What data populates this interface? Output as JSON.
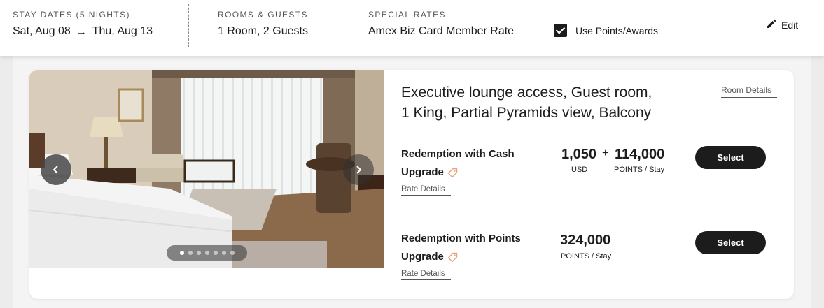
{
  "search_bar": {
    "stay_label": "STAY DATES (5 NIGHTS)",
    "check_in": "Sat, Aug 08",
    "check_out": "Thu, Aug 13",
    "rooms_label": "ROOMS & GUESTS",
    "rooms_value": "1 Room, 2 Guests",
    "special_label": "SPECIAL RATES",
    "special_value": "Amex Biz Card Member Rate",
    "use_points_label": "Use Points/Awards",
    "use_points_checked": true,
    "edit_label": "Edit"
  },
  "room": {
    "title_line1": "Executive lounge access, Guest room,",
    "title_line2": "1 King, Partial Pyramids view, Balcony",
    "room_details_label": "Room Details",
    "photo_count": 7,
    "photo_active_index": 0,
    "rates": [
      {
        "name_line1": "Redemption with Cash",
        "name_line2": "Upgrade",
        "rate_details_label": "Rate Details",
        "cash_amount": "1,050",
        "cash_unit": "USD",
        "plus": "+",
        "points_amount": "114,000",
        "points_unit": "POINTS / Stay",
        "select_label": "Select"
      },
      {
        "name_line1": "Redemption with Points",
        "name_line2": "Upgrade",
        "rate_details_label": "Rate Details",
        "points_amount": "324,000",
        "points_unit": "POINTS / Stay",
        "select_label": "Select"
      }
    ]
  },
  "icons": {
    "arrow": "arrow-right-icon",
    "edit": "pencil-icon",
    "tag": "tag-icon",
    "prev": "chevron-left-icon",
    "next": "chevron-right-icon"
  },
  "colors": {
    "primary": "#1c1c1c",
    "tag_accent": "#e8a27c"
  }
}
